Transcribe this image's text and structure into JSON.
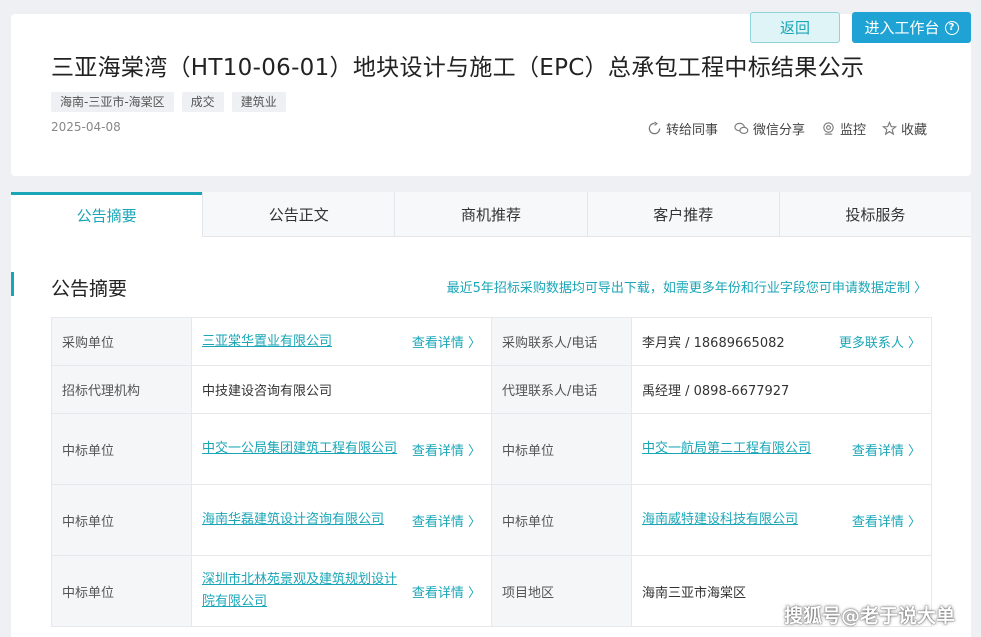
{
  "header": {
    "back_label": "返回",
    "workbench_label": "进入工作台",
    "title": "三亚海棠湾（HT10-06-01）地块设计与施工（EPC）总承包工程中标结果公示",
    "tags": [
      "海南-三亚市-海棠区",
      "成交",
      "建筑业"
    ],
    "date": "2025-04-08",
    "actions": {
      "forward": "转给同事",
      "wechat": "微信分享",
      "monitor": "监控",
      "favorite": "收藏"
    }
  },
  "tabs": [
    "公告摘要",
    "公告正文",
    "商机推荐",
    "客户推荐",
    "投标服务"
  ],
  "summary": {
    "title": "公告摘要",
    "export_link": "最近5年招标采购数据均可导出下载，如需更多年份和行业字段您可申请数据定制 〉"
  },
  "table": {
    "detail_label": "查看详情 〉",
    "more_contacts": "更多联系人 〉",
    "rows": [
      {
        "l1": "采购单位",
        "v1": "三亚棠华置业有限公司",
        "l2": "采购联系人/电话",
        "v2": "李月宾 / 18689665082"
      },
      {
        "l1": "招标代理机构",
        "v1": "中技建设咨询有限公司",
        "l2": "代理联系人/电话",
        "v2": "禹经理 / 0898-6677927"
      },
      {
        "l1": "中标单位",
        "v1": "中交一公局集团建筑工程有限公司",
        "l2": "中标单位",
        "v2": "中交一航局第二工程有限公司"
      },
      {
        "l1": "中标单位",
        "v1": "海南华磊建筑设计咨询有限公司",
        "l2": "中标单位",
        "v2": "海南威特建设科技有限公司"
      },
      {
        "l1": "中标单位",
        "v1": "深圳市北林苑景观及建筑规划设计院有限公司",
        "l2": "项目地区",
        "v2": "海南三亚市海棠区"
      }
    ]
  },
  "watermark": "搜狐号@老于说大单",
  "colors": {
    "accent": "#1aa6b7",
    "primary_button": "#1fa3d4"
  }
}
